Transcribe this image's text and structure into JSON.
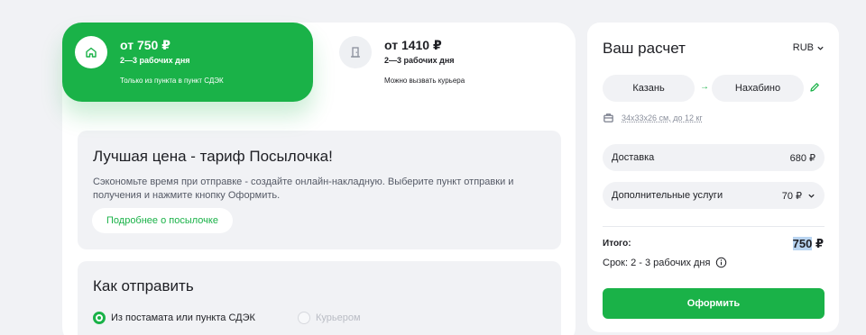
{
  "tariffs": [
    {
      "price": "от 750 ₽",
      "days": "2—3 рабочих дня",
      "note": "Только из пункта в пункт СДЭК",
      "icon": "home-icon"
    },
    {
      "price": "от 1410 ₽",
      "days": "2—3 рабочих дня",
      "note": "Можно вызвать курьера",
      "icon": "door-icon"
    }
  ],
  "promo": {
    "title": "Лучшая цена - тариф Посылочка!",
    "text": "Сэкономьте время при отправке - создайте онлайн-накладную. Выберите пункт отправки и получения и нажмите кнопку Оформить.",
    "button": "Подробнее о посылочке"
  },
  "how_to_send": {
    "title": "Как отправить",
    "options": [
      {
        "label": "Из постамата или пункта СДЭК",
        "selected": true
      },
      {
        "label": "Курьером",
        "selected": false
      }
    ]
  },
  "calc": {
    "title": "Ваш расчет",
    "currency": "RUB",
    "from": "Казань",
    "to": "Нахабино",
    "dims": "34x33x26 см, до 12 кг",
    "delivery_label": "Доставка",
    "delivery_value": "680 ₽",
    "extra_label": "Дополнительные услуги",
    "extra_value": "70 ₽",
    "total_label": "Итого:",
    "total_number": "750",
    "total_currency": "₽",
    "term": "Срок: 2 - 3 рабочих дня",
    "submit": "Оформить"
  },
  "colors": {
    "accent": "#1ab248",
    "background": "#f1f2f5"
  }
}
